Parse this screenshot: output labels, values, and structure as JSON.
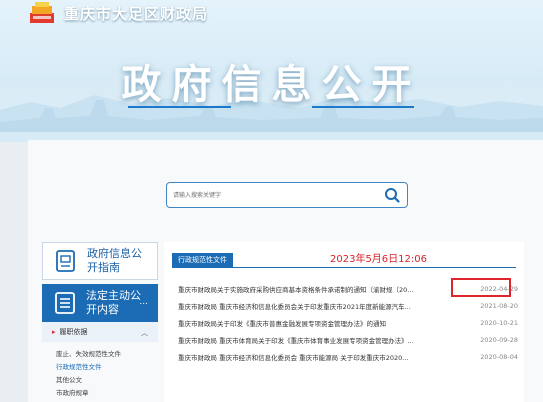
{
  "header": {
    "site_name": "重庆市大足区财政局",
    "banner_title": "政府信息公开",
    "logo_icon": "bureau-emblem-icon"
  },
  "search": {
    "placeholder": "请输入搜索关键字",
    "button_icon": "search-icon"
  },
  "sidebar": {
    "guide_label": "政府信息公开指南",
    "guide_icon": "guide-book-icon",
    "proactive_label": "法定主动公开内容",
    "proactive_icon": "list-doc-icon",
    "proactive_more": "...",
    "sub_heading": "履职依据",
    "sub_items": [
      "废止、失效规范性文件",
      "行政规范性文件",
      "其他公文",
      "市政府规章"
    ],
    "active_sub_index": 1
  },
  "content": {
    "category": "行政规范性文件",
    "datetime": "2023年5月6日12:06",
    "articles": [
      {
        "title": "重庆市财政局关于实施政府采购供应商基本资格条件承诺制的通知（渝财规〔20...",
        "date": "2022-04-29"
      },
      {
        "title": "重庆市财政局 重庆市经济和信息化委员会关于印发重庆市2021年度新能源汽车...",
        "date": "2021-08-20"
      },
      {
        "title": "重庆市财政局关于印发《重庆市普惠金融发展专项资金管理办法》的通知",
        "date": "2020-10-21"
      },
      {
        "title": "重庆市财政局 重庆市体育局关于印发《重庆市体育事业发展专项资金管理办法》...",
        "date": "2020-09-28"
      },
      {
        "title": "重庆市财政局 重庆市经济和信息化委员会 重庆市能源局 关于印发重庆市2020...",
        "date": "2020-08-04"
      }
    ],
    "highlighted_index": 0
  },
  "colors": {
    "accent": "#1b6cb4",
    "highlight": "#e0242b",
    "datetime": "#d8232a"
  }
}
